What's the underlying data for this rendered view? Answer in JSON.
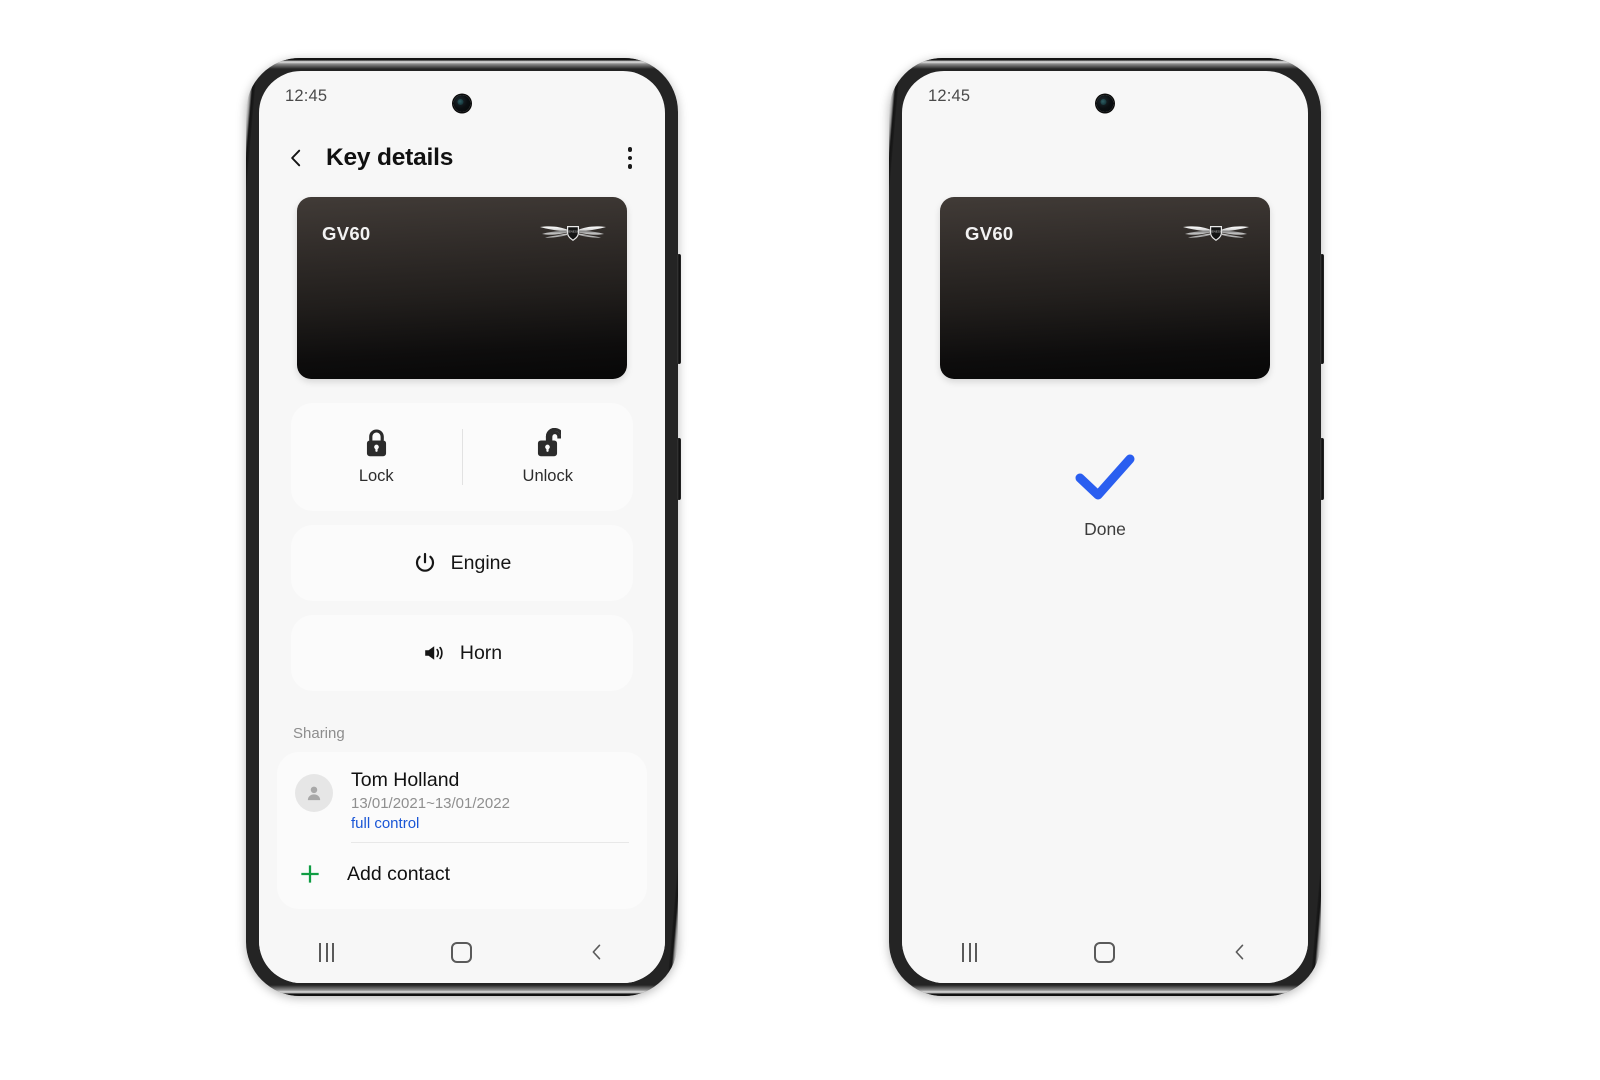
{
  "screens": [
    {
      "id": "key-details",
      "status_bar": {
        "time": "12:45",
        "camera_icon": "front-camera-icon"
      },
      "app_bar": {
        "back_icon": "chevron-left-icon",
        "title": "Key details",
        "more_icon": "more-vertical-icon"
      },
      "key_card": {
        "vehicle_name": "GV60",
        "brand_emblem": "genesis-wings-emblem",
        "gradient_top": "#413b37",
        "gradient_bottom": "#070707"
      },
      "lock_panel": [
        {
          "icon": "lock-closed-icon",
          "label": "Lock"
        },
        {
          "icon": "lock-open-icon",
          "label": "Unlock"
        }
      ],
      "actions": [
        {
          "icon": "power-icon",
          "label": "Engine"
        },
        {
          "icon": "horn-speaker-icon",
          "label": "Horn"
        }
      ],
      "sharing": {
        "heading": "Sharing",
        "contacts": [
          {
            "avatar_icon": "person-avatar-icon",
            "name": "Tom Holland",
            "dates": "13/01/2021~13/01/2022",
            "permission": "full control",
            "permission_color": "#1a56d6"
          }
        ],
        "add_contact": {
          "icon": "plus-icon",
          "icon_color": "#0f9d43",
          "label": "Add contact"
        }
      },
      "nav_bar": {
        "recents_icon": "recents-icon",
        "home_icon": "home-icon",
        "back_icon": "back-chevron-icon"
      }
    },
    {
      "id": "done",
      "status_bar": {
        "time": "12:45",
        "camera_icon": "front-camera-icon"
      },
      "key_card": {
        "vehicle_name": "GV60",
        "brand_emblem": "genesis-wings-emblem",
        "gradient_top": "#413b37",
        "gradient_bottom": "#070707"
      },
      "result": {
        "icon": "checkmark-icon",
        "icon_color": "#2a5ef0",
        "label": "Done"
      },
      "nav_bar": {
        "recents_icon": "recents-icon",
        "home_icon": "home-icon",
        "back_icon": "back-chevron-icon"
      }
    }
  ]
}
